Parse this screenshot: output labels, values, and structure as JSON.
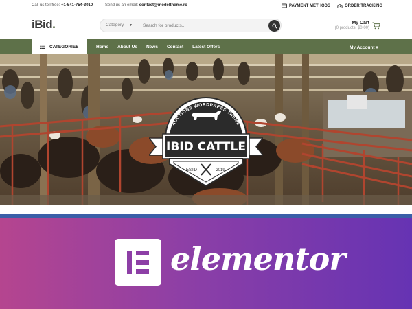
{
  "topbar": {
    "phone_label": "Call us toll free:",
    "phone": "+1-541-754-3010",
    "email_label": "Send us an email:",
    "email": "contact@modeltheme.ro",
    "payment": "PAYMENT METHODS",
    "tracking": "ORDER TRACKING"
  },
  "header": {
    "logo": "iBid",
    "logo_dot": ".",
    "category": "Category",
    "search_placeholder": "Search for products...",
    "cart_title": "My Cart",
    "cart_summary": "(0 products, $0.00)"
  },
  "nav": {
    "categories": "CATEGORIES",
    "links": [
      "Home",
      "About Us",
      "News",
      "Contact",
      "Latest Offers"
    ],
    "account": "My Account ▾"
  },
  "hero": {
    "badge_arc": "AUCTIONS WORDPRESS THEME",
    "badge_title": "IBID CATTLE",
    "badge_estd": "ESTD",
    "badge_year": "2019"
  },
  "banner": {
    "word": "elementor"
  },
  "colors": {
    "nav_green": "#5e7149",
    "banner_pink": "#b5458f",
    "banner_purple": "#6633b3",
    "divider_blue": "#3a5fa8"
  },
  "icons": [
    "payment-icon",
    "tracking-icon",
    "search-icon",
    "cart-icon",
    "menu-icon",
    "cow-icon",
    "elementor-logo-icon"
  ]
}
